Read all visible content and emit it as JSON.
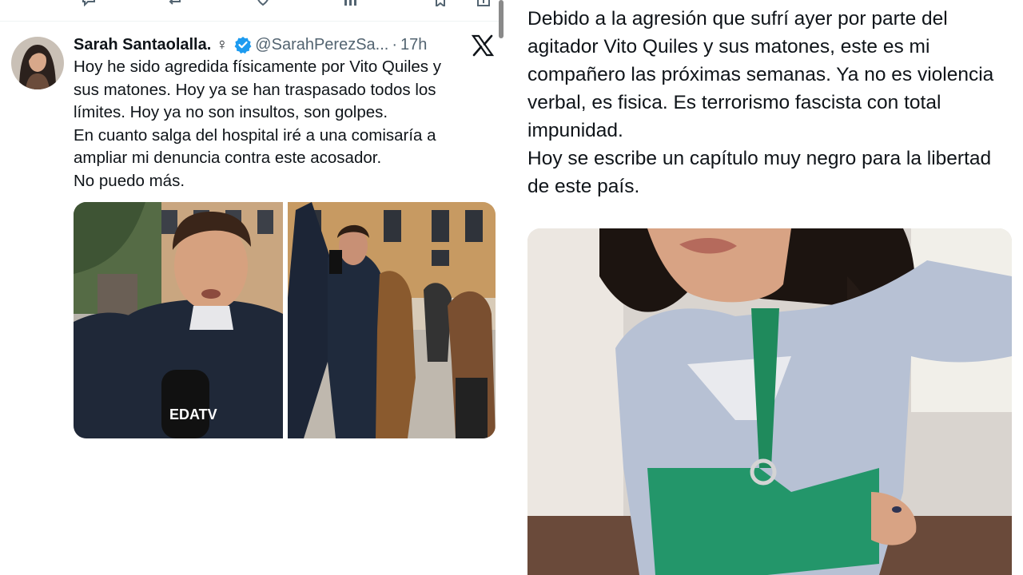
{
  "tweet": {
    "display_name": "Sarah Santaolalla.",
    "gender_symbol": "♀",
    "handle": "@SarahPerezSa...",
    "separator": "·",
    "time": "17h",
    "lines": [
      "Hoy he sido agredida físicamente por Vito Quiles y",
      "sus matones. Hoy ya se han traspasado todos los",
      "límites. Hoy ya no son insultos, son golpes.",
      "En cuanto salga del hospital iré a una comisaría a",
      "ampliar mi denuncia contra este acosador.",
      "No puedo más."
    ],
    "mic_logo_text": "EDATV"
  },
  "right_post": {
    "lines": [
      "Debido a la agresión que sufrí ayer por parte del",
      "agitador Vito Quiles y sus matones, este es mi",
      "compañero las próximas semanas. Ya no es violencia",
      "verbal, es fisica. Es terrorismo fascista con total",
      "impunidad.",
      "Hoy se escribe un capítulo muy negro para la libertad",
      "de este país."
    ]
  },
  "colors": {
    "verified_blue": "#1d9bf0",
    "secondary_text": "#536471",
    "primary_text": "#0f1419",
    "sling_green": "#1f8a5c"
  },
  "icons": [
    "reply-icon",
    "repost-icon",
    "like-icon",
    "stats-icon",
    "bookmark-icon",
    "share-icon",
    "verified-badge-icon",
    "x-logo-icon"
  ]
}
